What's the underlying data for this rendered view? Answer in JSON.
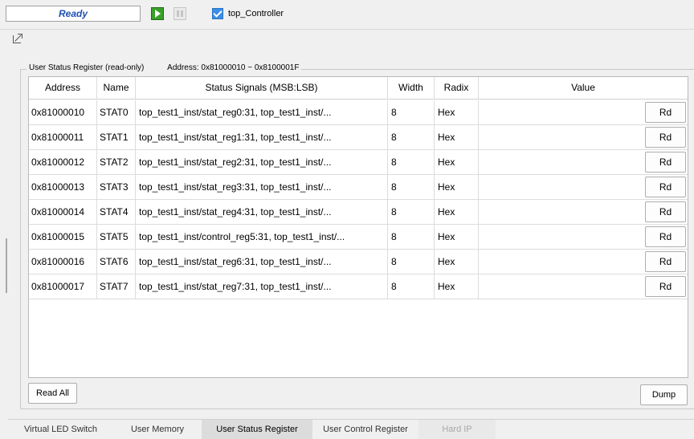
{
  "toolbar": {
    "status": "Ready",
    "run_icon": "run-icon",
    "stop_icon": "stop-icon",
    "controller_label": "top_Controller",
    "controller_checked": true
  },
  "group": {
    "title": "User Status Register (read-only)",
    "address_range": "Address: 0x81000010 ~ 0x8100001F"
  },
  "table": {
    "columns": [
      "Address",
      "Name",
      "Status Signals (MSB:LSB)",
      "Width",
      "Radix",
      "Value"
    ],
    "rows": [
      {
        "address": "0x81000010",
        "name": "STAT0",
        "signals": "top_test1_inst/stat_reg0:31, top_test1_inst/...",
        "width": "8",
        "radix": "Hex",
        "value": "",
        "button": "Rd"
      },
      {
        "address": "0x81000011",
        "name": "STAT1",
        "signals": "top_test1_inst/stat_reg1:31, top_test1_inst/...",
        "width": "8",
        "radix": "Hex",
        "value": "",
        "button": "Rd"
      },
      {
        "address": "0x81000012",
        "name": "STAT2",
        "signals": "top_test1_inst/stat_reg2:31, top_test1_inst/...",
        "width": "8",
        "radix": "Hex",
        "value": "",
        "button": "Rd"
      },
      {
        "address": "0x81000013",
        "name": "STAT3",
        "signals": "top_test1_inst/stat_reg3:31, top_test1_inst/...",
        "width": "8",
        "radix": "Hex",
        "value": "",
        "button": "Rd"
      },
      {
        "address": "0x81000014",
        "name": "STAT4",
        "signals": "top_test1_inst/stat_reg4:31, top_test1_inst/...",
        "width": "8",
        "radix": "Hex",
        "value": "",
        "button": "Rd"
      },
      {
        "address": "0x81000015",
        "name": "STAT5",
        "signals": "top_test1_inst/control_reg5:31, top_test1_inst/...",
        "width": "8",
        "radix": "Hex",
        "value": "",
        "button": "Rd"
      },
      {
        "address": "0x81000016",
        "name": "STAT6",
        "signals": "top_test1_inst/stat_reg6:31, top_test1_inst/...",
        "width": "8",
        "radix": "Hex",
        "value": "",
        "button": "Rd"
      },
      {
        "address": "0x81000017",
        "name": "STAT7",
        "signals": "top_test1_inst/stat_reg7:31, top_test1_inst/...",
        "width": "8",
        "radix": "Hex",
        "value": "",
        "button": "Rd"
      }
    ]
  },
  "buttons": {
    "read_all": "Read All",
    "dump": "Dump"
  },
  "tabs": [
    {
      "label": "Virtual LED Switch",
      "state": "normal"
    },
    {
      "label": "User Memory",
      "state": "normal"
    },
    {
      "label": "User Status Register",
      "state": "active"
    },
    {
      "label": "User Control Register",
      "state": "normal"
    },
    {
      "label": "Hard IP",
      "state": "disabled"
    }
  ],
  "colors": {
    "status_text": "#1f4fb0",
    "run_icon": "#3aa02a",
    "checkbox": "#3a8ee6",
    "active_tab": "#dcdcdc"
  }
}
